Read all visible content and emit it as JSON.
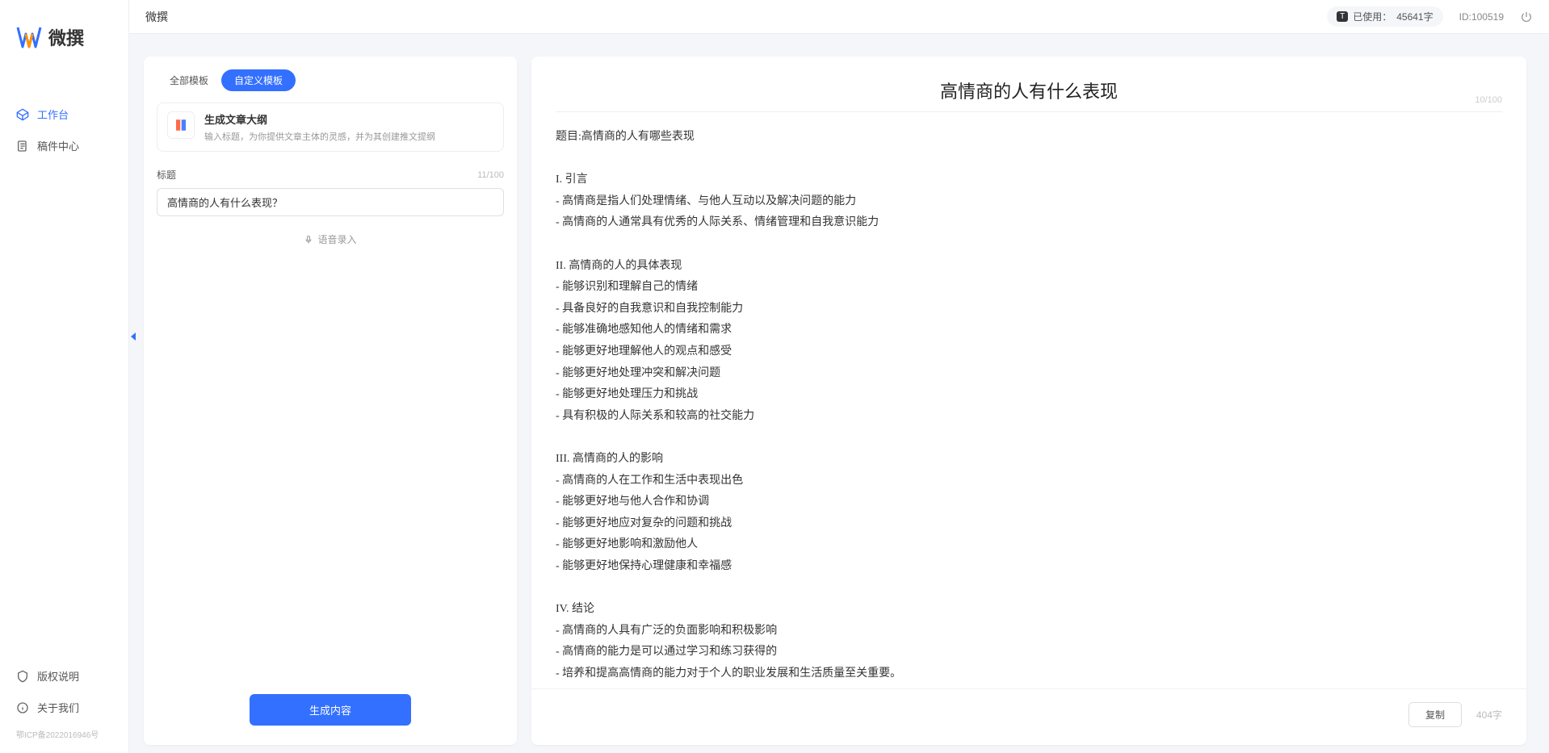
{
  "app_name": "微撰",
  "header": {
    "title": "微撰",
    "usage_label": "已使用：",
    "usage_value": "45641字",
    "usage_badge": "T",
    "user_id": "ID:100519"
  },
  "sidebar": {
    "items": [
      {
        "label": "工作台",
        "icon": "cube-icon",
        "active": true
      },
      {
        "label": "稿件中心",
        "icon": "doc-icon",
        "active": false
      }
    ],
    "footer_items": [
      {
        "label": "版权说明",
        "icon": "shield-icon"
      },
      {
        "label": "关于我们",
        "icon": "info-icon"
      }
    ],
    "icp": "鄂ICP备2022016946号"
  },
  "tabs": {
    "all": "全部模板",
    "custom": "自定义模板"
  },
  "template": {
    "title": "生成文章大纲",
    "desc": "输入标题，为你提供文章主体的灵感，并为其创建推文提纲"
  },
  "form": {
    "title_label": "标题",
    "title_count": "11/100",
    "title_value": "高情商的人有什么表现？",
    "voice_label": "语音录入",
    "generate_label": "生成内容"
  },
  "output": {
    "title": "高情商的人有什么表现",
    "title_count": "10/100",
    "body": "题目:高情商的人有哪些表现\n\nI. 引言\n- 高情商是指人们处理情绪、与他人互动以及解决问题的能力\n- 高情商的人通常具有优秀的人际关系、情绪管理和自我意识能力\n\nII. 高情商的人的具体表现\n- 能够识别和理解自己的情绪\n- 具备良好的自我意识和自我控制能力\n- 能够准确地感知他人的情绪和需求\n- 能够更好地理解他人的观点和感受\n- 能够更好地处理冲突和解决问题\n- 能够更好地处理压力和挑战\n- 具有积极的人际关系和较高的社交能力\n\nIII. 高情商的人的影响\n- 高情商的人在工作和生活中表现出色\n- 能够更好地与他人合作和协调\n- 能够更好地应对复杂的问题和挑战\n- 能够更好地影响和激励他人\n- 能够更好地保持心理健康和幸福感\n\nIV. 结论\n- 高情商的人具有广泛的负面影响和积极影响\n- 高情商的能力是可以通过学习和练习获得的\n- 培养和提高高情商的能力对于个人的职业发展和生活质量至关重要。",
    "copy_label": "复制",
    "word_count": "404字"
  }
}
